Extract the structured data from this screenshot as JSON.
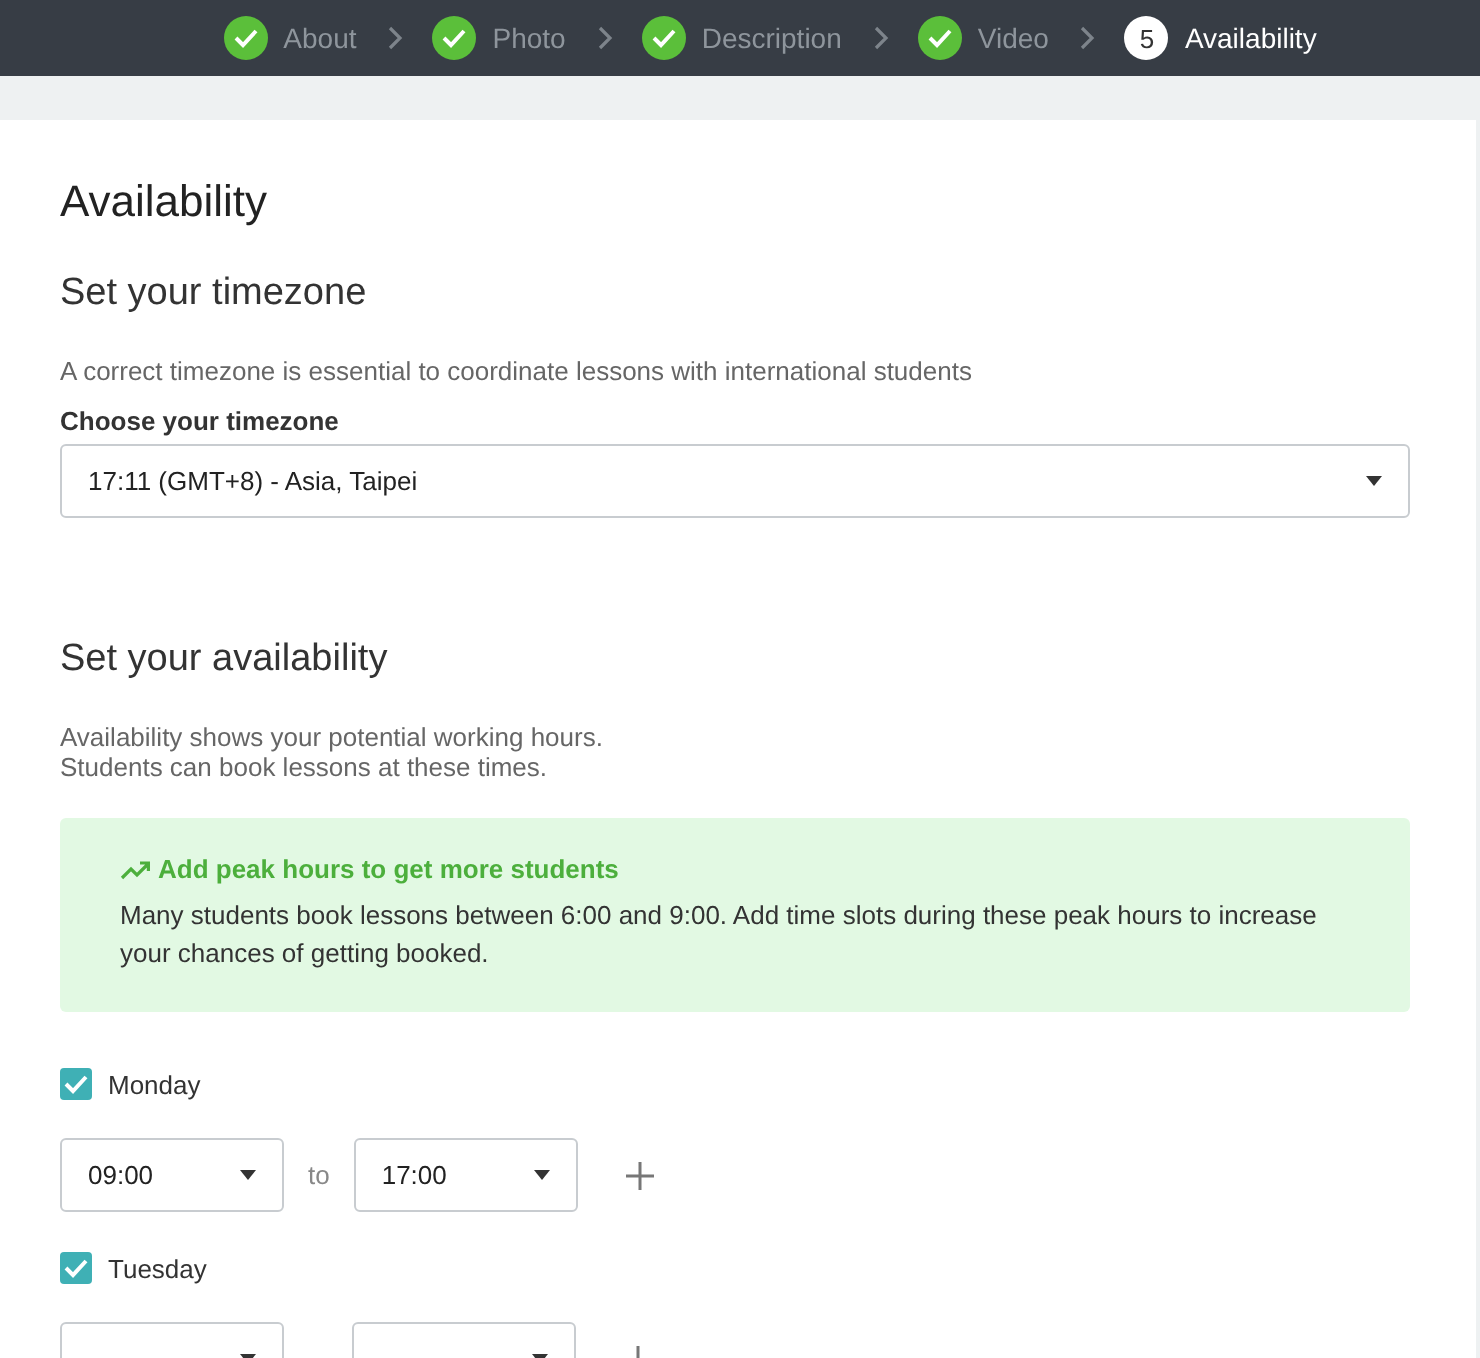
{
  "steps": [
    {
      "label": "About",
      "completed": true,
      "selected": false
    },
    {
      "label": "Photo",
      "completed": true,
      "selected": false
    },
    {
      "label": "Description",
      "completed": true,
      "selected": false
    },
    {
      "label": "Video",
      "completed": true,
      "selected": false
    },
    {
      "label": "Availability",
      "completed": false,
      "selected": true,
      "number": "5"
    }
  ],
  "title": "Availability",
  "timezone": {
    "heading": "Set your timezone",
    "description": "A correct timezone is essential to coordinate lessons with international students",
    "label": "Choose your timezone",
    "value": "17:11 (GMT+8) - Asia, Taipei"
  },
  "availability": {
    "heading": "Set your availability",
    "description": [
      "Availability shows your potential working hours.",
      "Students can book lessons at these times."
    ],
    "tip": {
      "title": "Add peak hours to get more students",
      "text": "Many students book lessons between 6:00 and 9:00. Add time slots during these peak hours to increase your chances of getting booked."
    },
    "days": [
      {
        "name": "Monday",
        "checked": true,
        "from": "09:00",
        "separator": "to",
        "to": "17:00"
      },
      {
        "name": "Tuesday",
        "checked": true
      }
    ]
  }
}
